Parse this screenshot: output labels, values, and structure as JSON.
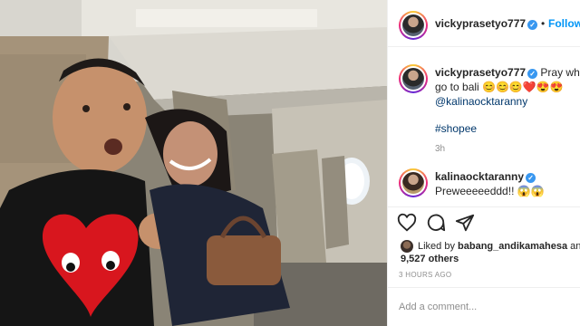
{
  "post": {
    "author": "vickyprasetyo777",
    "follow_label": "Follow",
    "separator": "•"
  },
  "caption": {
    "author": "vickyprasetyo777",
    "text_line1": "Pray white j",
    "text_line2": "go to bali 😊😊😊❤️😍😍",
    "mention": "@kalinaocktaranny",
    "hashtag": "#shopee",
    "time": "3h"
  },
  "comment": {
    "author": "kalinaocktaranny",
    "text": "Preweeeeeddd!! 😱😱"
  },
  "likes": {
    "liked_by_prefix": "Liked by ",
    "liked_by_user": "babang_andikamahesa",
    "liked_by_suffix": " and",
    "count": "9,527 others",
    "posted_time": "3 HOURS AGO"
  },
  "add_comment": {
    "placeholder": "Add a comment..."
  },
  "icons": [
    "heart-icon",
    "comment-icon",
    "share-icon",
    "verified-icon"
  ],
  "colors": {
    "follow": "#0095f6",
    "verified": "#3897f0",
    "mention": "#00376b",
    "muted": "#8e8e8e"
  }
}
